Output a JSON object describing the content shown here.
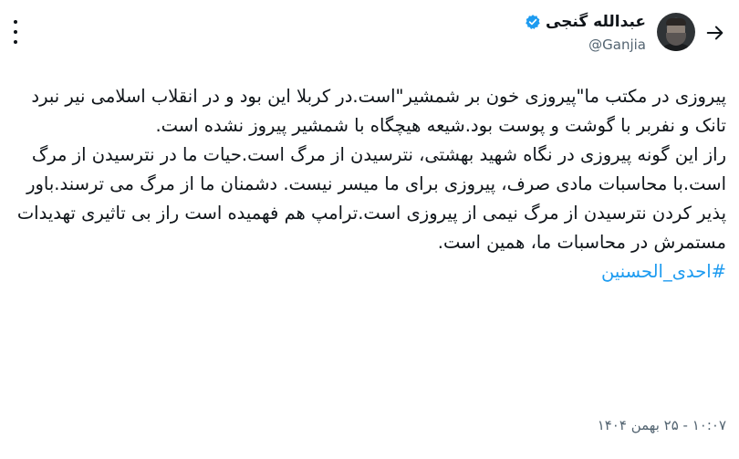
{
  "author": {
    "name": "عبدالله گنجی",
    "handle": "@Ganjia",
    "verified": true
  },
  "icons": {
    "back": "arrow-right-icon",
    "verified": "verified-badge-icon",
    "more": "more-vertical-icon"
  },
  "tweet": {
    "paragraph_1": "پیروزی در مکتب ما\"پیروزی خون بر شمشیر\"است.در کربلا این بود و در انقلاب اسلامی نیر نبرد تانک و نفربر با گوشت و پوست بود.شیعه هیچگاه با شمشیر پیروز نشده است.",
    "paragraph_2": "راز این گونه پیروزی در نگاه شهید بهشتی، نترسیدن از مرگ است.حیات ما در نترسیدن از مرگ است.با محاسبات مادی صرف، پیروزی برای ما میسر نیست. دشمنان ما از مرگ می ترسند.باور پذیر کردن نترسیدن از مرگ نیمی از پیروزی است.ترامپ هم فهمیده است راز بی تاثیری تهدیدات مستمرش در محاسبات ما، همین است.",
    "hashtag": "#احدی_الحسنین"
  },
  "meta": {
    "timestamp": "۱۰:۰۷ - ۲۵ بهمن ۱۴۰۴"
  },
  "colors": {
    "link": "#1d9bf0",
    "secondary_text": "#536471",
    "text": "#0f1419"
  }
}
